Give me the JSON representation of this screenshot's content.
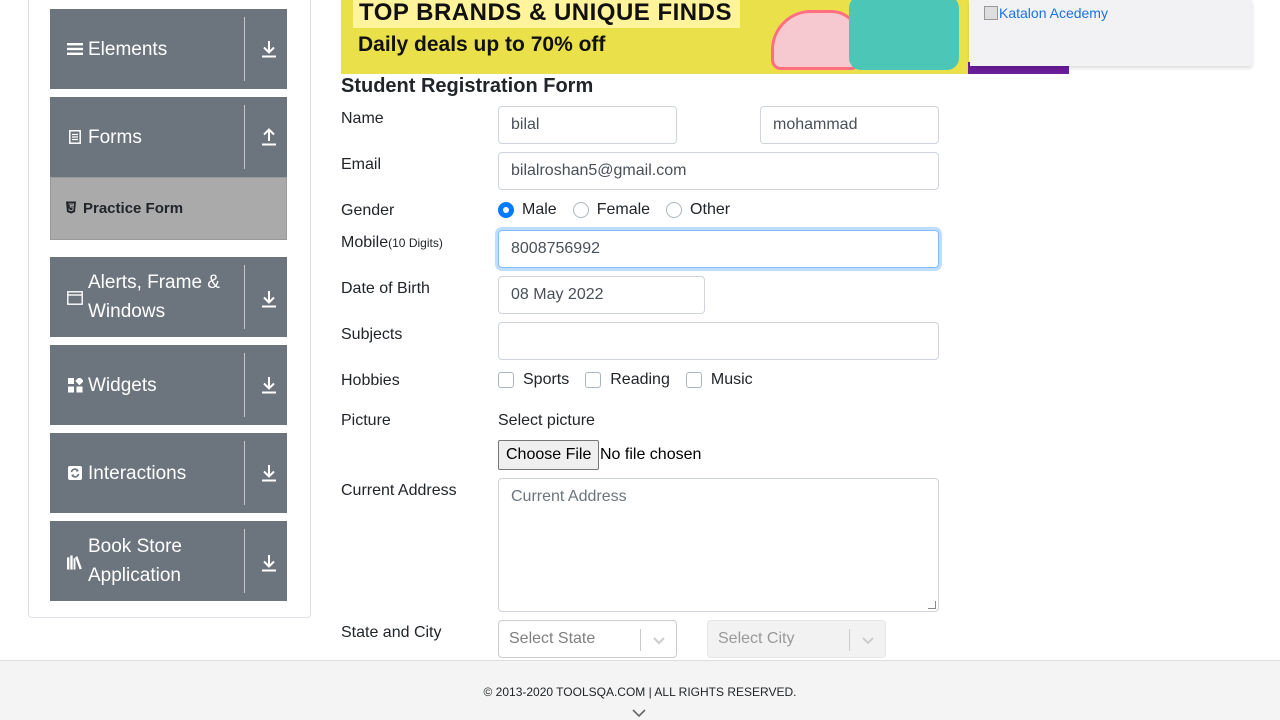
{
  "sidebar": {
    "groups": [
      {
        "label": "Elements",
        "icon": "hamburger-icon"
      },
      {
        "label": "Forms",
        "icon": "document-icon"
      },
      {
        "label": "Alerts, Frame & Windows",
        "icon": "window-icon"
      },
      {
        "label": "Widgets",
        "icon": "widgets-icon"
      },
      {
        "label": "Interactions",
        "icon": "interactions-icon"
      },
      {
        "label": "Book Store Application",
        "icon": "books-icon"
      }
    ],
    "active_item": {
      "label": "Practice Form",
      "icon": "html5-icon"
    }
  },
  "banner": {
    "headline": "TOP BRANDS & UNIQUE FINDS",
    "subline": "Daily deals up to 70% off"
  },
  "ad": {
    "link_text": "Katalon Acedemy"
  },
  "form": {
    "title": "Student Registration Form",
    "name_label": "Name",
    "first_name_value": "bilal",
    "last_name_value": "mohammad",
    "email_label": "Email",
    "email_value": "bilalroshan5@gmail.com",
    "gender_label": "Gender",
    "gender_options": [
      "Male",
      "Female",
      "Other"
    ],
    "gender_selected": "Male",
    "mobile_label": "Mobile",
    "mobile_hint": "(10 Digits)",
    "mobile_value": "8008756992",
    "dob_label": "Date of Birth",
    "dob_value": "08 May 2022",
    "subjects_label": "Subjects",
    "subjects_value": "",
    "hobbies_label": "Hobbies",
    "hobbies_options": [
      "Sports",
      "Reading",
      "Music"
    ],
    "picture_label": "Picture",
    "picture_hint": "Select picture",
    "file_button": "Choose File",
    "file_status": "No file chosen",
    "address_label": "Current Address",
    "address_placeholder": "Current Address",
    "state_city_label": "State and City",
    "state_placeholder": "Select State",
    "city_placeholder": "Select City"
  },
  "footer": {
    "text": "© 2013-2020 TOOLSQA.COM | ALL RIGHTS RESERVED."
  },
  "colors": {
    "sidebar_group": "#6c757d",
    "active_item": "#aaaaaa",
    "radio_selected": "#007bff",
    "banner": "#eae14a",
    "focus_border": "#80bdff"
  }
}
